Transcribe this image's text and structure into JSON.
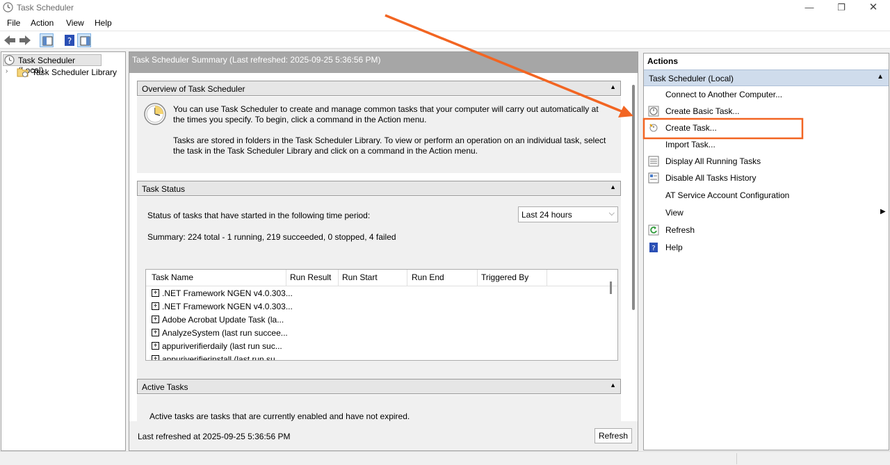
{
  "window": {
    "title": "Task Scheduler"
  },
  "menu": [
    "File",
    "Action",
    "View",
    "Help"
  ],
  "tree": {
    "root": "Task Scheduler (Local)",
    "child": "Task Scheduler Library"
  },
  "center": {
    "header": "Task Scheduler Summary (Last refreshed: 2025-09-25 5:36:56 PM)",
    "overview": {
      "title": "Overview of Task Scheduler",
      "p1": "You can use Task Scheduler to create and manage common tasks that your computer will carry out automatically at the times you specify. To begin, click a command in the Action menu.",
      "p2": "Tasks are stored in folders in the Task Scheduler Library. To view or perform an operation on an individual task, select the task in the Task Scheduler Library and click on a command in the Action menu."
    },
    "status": {
      "title": "Task Status",
      "period_label": "Status of tasks that have started in the following time period:",
      "period_value": "Last 24 hours",
      "summary": "Summary: 224 total - 1 running, 219 succeeded, 0 stopped, 4 failed",
      "columns": [
        "Task Name",
        "Run Result",
        "Run Start",
        "Run End",
        "Triggered By"
      ],
      "rows": [
        ".NET Framework NGEN v4.0.303...",
        ".NET Framework NGEN v4.0.303...",
        "Adobe Acrobat Update Task (la...",
        "AnalyzeSystem (last run succee...",
        "appuriverifierdaily (last run suc...",
        "appuriverifierinstall (last run su..."
      ]
    },
    "active": {
      "title": "Active Tasks",
      "text": "Active tasks are tasks that are currently enabled and have not expired."
    },
    "footer": {
      "last_refreshed": "Last refreshed at 2025-09-25 5:36:56 PM",
      "refresh_button": "Refresh"
    }
  },
  "actions": {
    "title": "Actions",
    "group": "Task Scheduler (Local)",
    "items": [
      "Connect to Another Computer...",
      "Create Basic Task...",
      "Create Task...",
      "Import Task...",
      "Display All Running Tasks",
      "Disable All Tasks History",
      "AT Service Account Configuration",
      "View",
      "Refresh",
      "Help"
    ]
  },
  "colors": {
    "highlight": "#f26522",
    "group_header": "#cfdcec"
  }
}
